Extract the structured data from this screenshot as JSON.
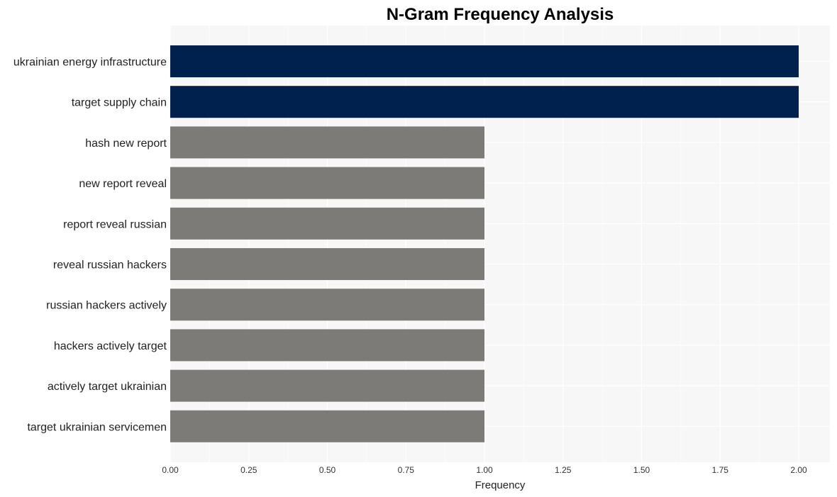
{
  "chart_data": {
    "type": "bar",
    "orientation": "horizontal",
    "title": "N-Gram Frequency Analysis",
    "xlabel": "Frequency",
    "ylabel": "",
    "xlim": [
      0,
      2.1
    ],
    "x_ticks": [
      "0.00",
      "0.25",
      "0.50",
      "0.75",
      "1.00",
      "1.25",
      "1.50",
      "1.75",
      "2.00"
    ],
    "grid": true,
    "legend": "none",
    "categories": [
      "ukrainian energy infrastructure",
      "target supply chain",
      "hash new report",
      "new report reveal",
      "report reveal russian",
      "reveal russian hackers",
      "russian hackers actively",
      "hackers actively target",
      "actively target ukrainian",
      "target ukrainian servicemen"
    ],
    "values": [
      2,
      2,
      1,
      1,
      1,
      1,
      1,
      1,
      1,
      1
    ],
    "colors": {
      "highlight": "#00214d",
      "default": "#7d7b77",
      "panel": "#f7f7f7",
      "grid": "#ffffff"
    }
  }
}
